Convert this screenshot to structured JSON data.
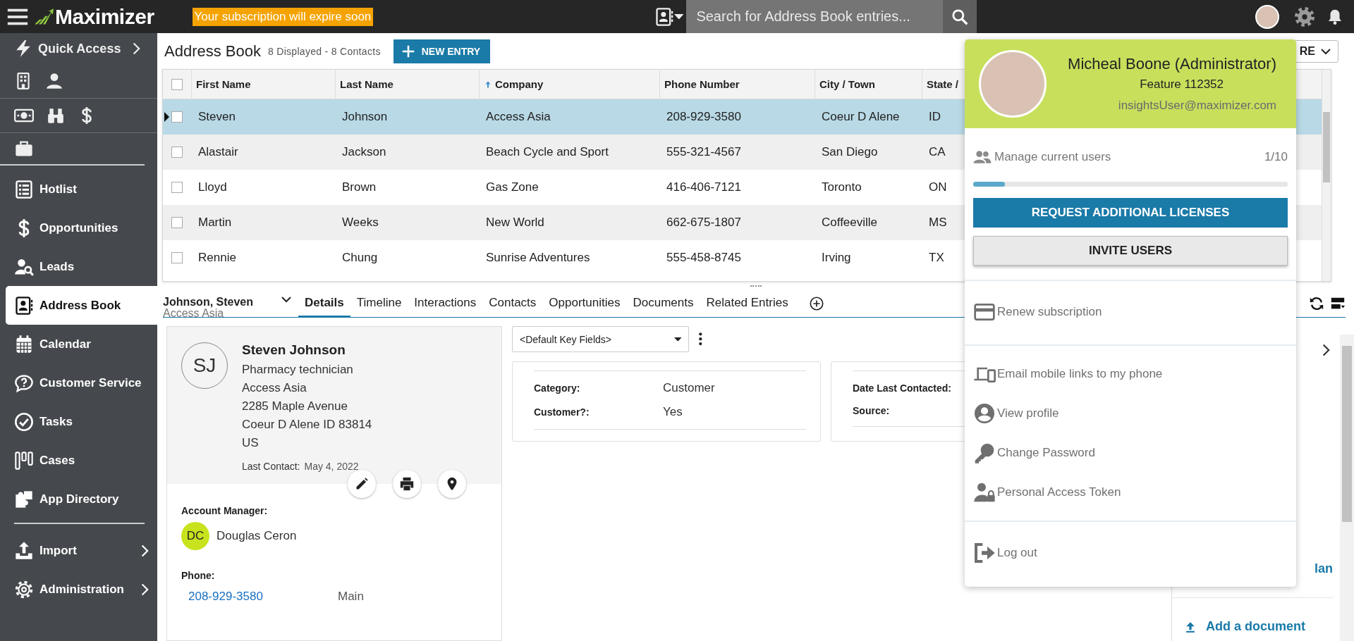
{
  "topbar": {
    "brand": "Maximizer",
    "notice": "Your subscription will expire soon",
    "search": {
      "placeholder": "Search for Address Book entries..."
    }
  },
  "sidebar": {
    "quick_access": "Quick Access",
    "items": [
      {
        "label": "Hotlist",
        "selected": false
      },
      {
        "label": "Opportunities",
        "selected": false
      },
      {
        "label": "Leads",
        "selected": false
      },
      {
        "label": "Address Book",
        "selected": true
      },
      {
        "label": "Calendar",
        "selected": false
      },
      {
        "label": "Customer Service",
        "selected": false
      },
      {
        "label": "Tasks",
        "selected": false
      },
      {
        "label": "Cases",
        "selected": false
      },
      {
        "label": "App Directory",
        "selected": false
      }
    ],
    "lower_items": [
      {
        "label": "Import",
        "selected": false
      },
      {
        "label": "Administration",
        "selected": false
      }
    ]
  },
  "header": {
    "title": "Address Book",
    "count": "8 Displayed - 8 Contacts",
    "new_button": "NEW ENTRY",
    "more_button": "RE"
  },
  "table": {
    "all_checked": false,
    "columns": [
      {
        "label": "First Name",
        "sorted": false
      },
      {
        "label": "Last Name",
        "sorted": false
      },
      {
        "label": "Company",
        "sorted": true
      },
      {
        "label": "Phone Number",
        "sorted": false
      },
      {
        "label": "City / Town",
        "sorted": false
      },
      {
        "label": "State /",
        "sorted": false
      }
    ],
    "rows": [
      {
        "cells": [
          "Steven",
          "Johnson",
          "Access Asia",
          "208-929-3580",
          "Coeur D Alene",
          "ID"
        ],
        "selected": true,
        "checked": false
      },
      {
        "cells": [
          "Alastair",
          "Jackson",
          "Beach Cycle and Sport",
          "555-321-4567",
          "San Diego",
          "CA"
        ],
        "selected": false,
        "checked": false
      },
      {
        "cells": [
          "Lloyd",
          "Brown",
          "Gas Zone",
          "416-406-7121",
          "Toronto",
          "ON"
        ],
        "selected": false,
        "checked": false
      },
      {
        "cells": [
          "Martin",
          "Weeks",
          "New World",
          "662-675-1807",
          "Coffeeville",
          "MS"
        ],
        "selected": false,
        "checked": false
      },
      {
        "cells": [
          "Rennie",
          "Chung",
          "Sunrise Adventures",
          "555-458-8745",
          "Irving",
          "TX"
        ],
        "selected": false,
        "checked": false
      }
    ]
  },
  "detail": {
    "name": "Johnson, Steven",
    "company": "Access Asia",
    "tabs": [
      {
        "label": "Details",
        "selected": true
      },
      {
        "label": "Timeline",
        "selected": false
      },
      {
        "label": "Interactions",
        "selected": false
      },
      {
        "label": "Contacts",
        "selected": false
      },
      {
        "label": "Opportunities",
        "selected": false
      },
      {
        "label": "Documents",
        "selected": false
      },
      {
        "label": "Related Entries",
        "selected": false
      }
    ],
    "card": {
      "initials": "SJ",
      "name": "Steven Johnson",
      "lines": [
        "Pharmacy technician",
        "Access Asia",
        "2285 Maple Avenue",
        "Coeur D Alene ID 83814",
        "US"
      ],
      "last_contact_label": "Last Contact:",
      "last_contact": "May 4, 2022",
      "account_manager_label": "Account Manager:",
      "manager": {
        "initials": "DC",
        "name": "Douglas Ceron",
        "color": "#c8e21e"
      },
      "phone_label": "Phone:",
      "phone": "208-929-3580",
      "phone_type": "Main"
    },
    "key_fields": {
      "select": "<Default Key Fields>",
      "cards": [
        {
          "fields": [
            {
              "label": "Category:",
              "value": "Customer"
            },
            {
              "label": "Customer?:",
              "value": "Yes"
            }
          ]
        },
        {
          "fields": [
            {
              "label": "Date Last Contacted:"
            },
            {
              "label": "Source:"
            }
          ]
        }
      ]
    },
    "side_panel": {
      "link": "lan",
      "add_document": "Add a document"
    }
  },
  "profile_menu": {
    "name": "Micheal Boone (Administrator)",
    "feature": "Feature 112352",
    "email": "insightsUser@maximizer.com",
    "users": {
      "label": "Manage current users",
      "count": "1/10",
      "level": 0.1
    },
    "request_button": "REQUEST ADDITIONAL LICENSES",
    "invite_button": "INVITE USERS",
    "sections": [
      {
        "items": [
          {
            "label": "Renew subscription"
          }
        ]
      },
      {
        "items": [
          {
            "label": "Email mobile links to my phone"
          },
          {
            "label": "View profile"
          },
          {
            "label": "Change Password"
          },
          {
            "label": "Personal Access Token"
          }
        ]
      },
      {
        "items": [
          {
            "label": "Log out"
          }
        ]
      }
    ]
  }
}
